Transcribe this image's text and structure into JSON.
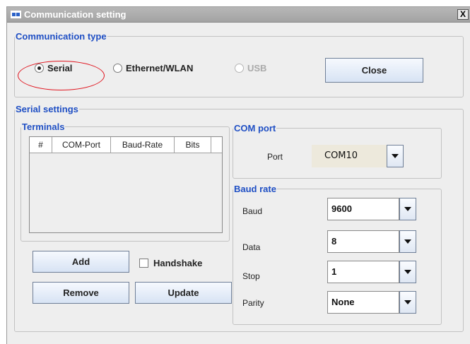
{
  "window": {
    "title": "Communication setting",
    "close_glyph": "X"
  },
  "comm_type": {
    "legend": "Communication type",
    "options": [
      {
        "label": "Serial",
        "selected": true,
        "enabled": true
      },
      {
        "label": "Ethernet/WLAN",
        "selected": false,
        "enabled": true
      },
      {
        "label": "USB",
        "selected": false,
        "enabled": false
      }
    ],
    "close_button": "Close"
  },
  "serial": {
    "legend": "Serial settings",
    "terminals": {
      "legend": "Terminals",
      "columns": [
        "#",
        "COM-Port",
        "Baud-Rate",
        "Bits"
      ],
      "rows": []
    },
    "add_button": "Add",
    "handshake_label": "Handshake",
    "handshake_checked": false,
    "remove_button": "Remove",
    "update_button": "Update"
  },
  "com_port": {
    "legend": "COM port",
    "port_label": "Port",
    "port_value": "COM10"
  },
  "baud_rate": {
    "legend": "Baud rate",
    "baud_label": "Baud",
    "baud_value": "9600",
    "data_label": "Data",
    "data_value": "8",
    "stop_label": "Stop",
    "stop_value": "1",
    "parity_label": "Parity",
    "parity_value": "None"
  },
  "colors": {
    "legend_blue": "#1f4fc4",
    "highlight_red": "#e0141e"
  },
  "icons": {
    "app": "app-icon",
    "window_close": "close-icon",
    "dropdown": "chevron-down-icon"
  }
}
